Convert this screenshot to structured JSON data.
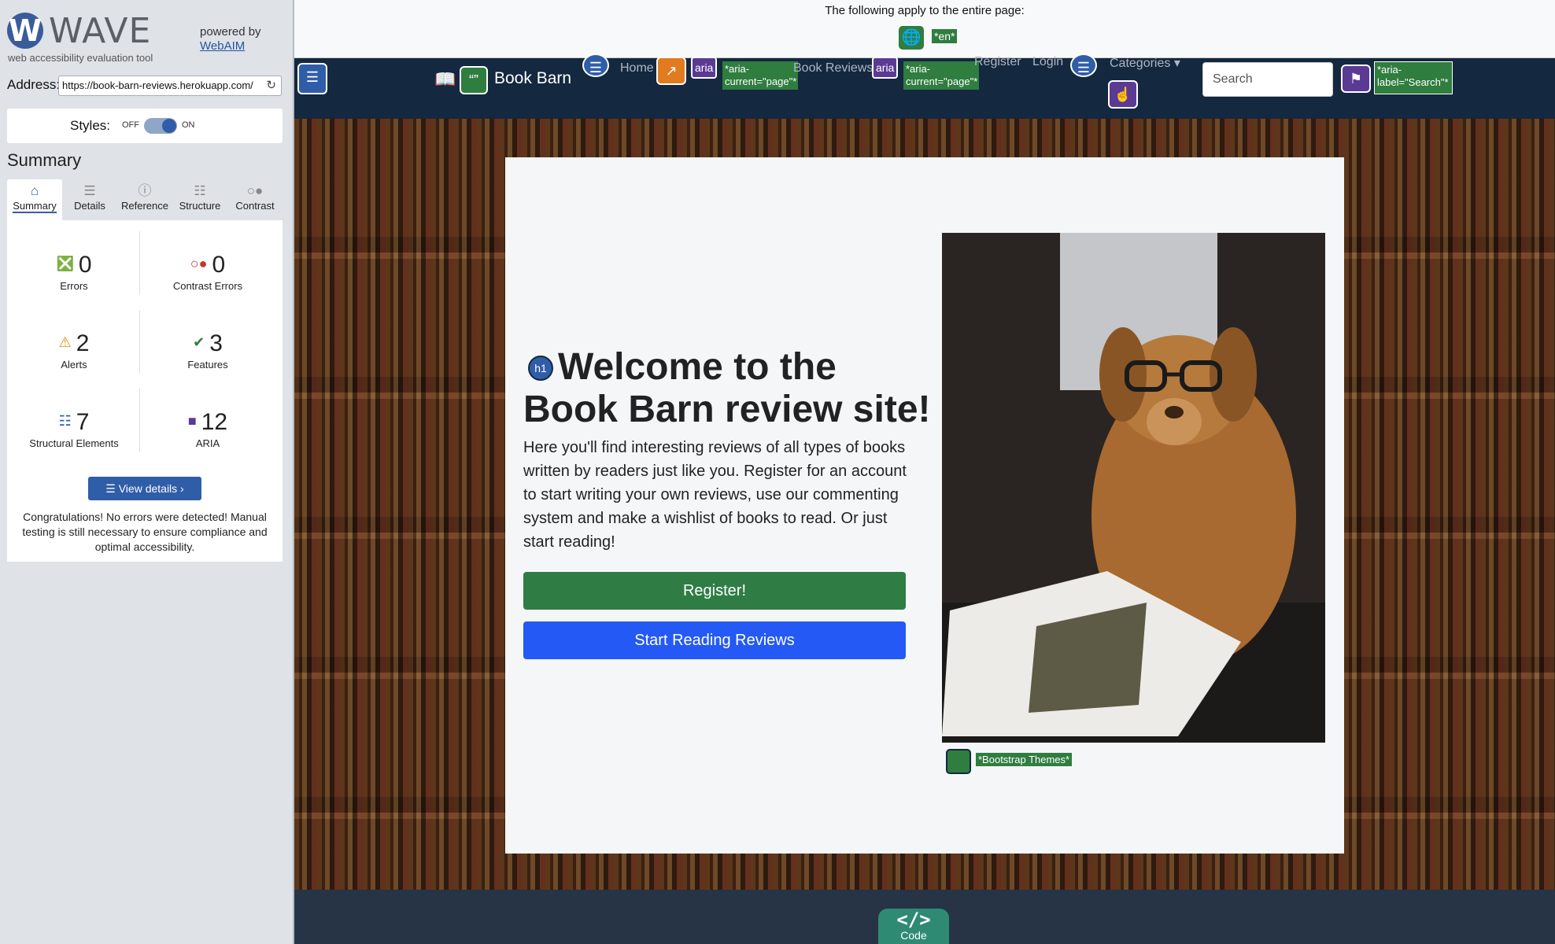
{
  "wave": {
    "logo_text": "WAVE",
    "tagline": "web accessibility evaluation tool",
    "powered_by": "powered by",
    "webaim_link": "WebAIM",
    "address_label": "Address:",
    "address_value": "https://book-barn-reviews.herokuapp.com/",
    "styles_label": "Styles:",
    "styles_off": "OFF",
    "styles_on": "ON",
    "summary_heading": "Summary",
    "tabs": [
      {
        "label": "Summary",
        "icon": "home-icon",
        "active": true
      },
      {
        "label": "Details",
        "icon": "list-icon"
      },
      {
        "label": "Reference",
        "icon": "info-icon"
      },
      {
        "label": "Structure",
        "icon": "hierarchy-icon"
      },
      {
        "label": "Contrast",
        "icon": "contrast-icon"
      }
    ],
    "stats": {
      "errors": {
        "value": "0",
        "label": "Errors"
      },
      "contrast_errors": {
        "value": "0",
        "label": "Contrast Errors"
      },
      "alerts": {
        "value": "2",
        "label": "Alerts"
      },
      "features": {
        "value": "3",
        "label": "Features"
      },
      "structural": {
        "value": "7",
        "label": "Structural Elements"
      },
      "aria": {
        "value": "12",
        "label": "ARIA"
      }
    },
    "view_details": "View details ›",
    "congrats": "Congratulations! No errors were detected! Manual testing is still necessary to ensure compliance and optimal accessibility."
  },
  "page_note": {
    "text": "The following apply to the entire page:",
    "lang_tag": "*en*"
  },
  "nav": {
    "brand": "Book Barn",
    "home": "Home",
    "book_reviews": "Book Reviews",
    "aria_current_1": "*aria-current=\"page\"*",
    "aria_current_2": "*aria-current=\"page\"*",
    "aria_label_tag": "aria",
    "register": "Register",
    "login": "Login",
    "categories": "Categories",
    "search_placeholder": "Search",
    "aria_label_search": "*aria-label=\"Search\"*"
  },
  "hero": {
    "heading_tag": "h1",
    "heading": "Welcome to the Book Barn review site!",
    "lead": "Here you'll find interesting reviews of all types of books written by readers just like you. Register for an account to start writing your own reviews, use our commenting system and make a wishlist of books to read. Or just start reading!",
    "register_button": "Register!",
    "start_button": "Start Reading Reviews",
    "image_alt_tag": "*Bootstrap Themes*"
  },
  "footer": {
    "code_label": "Code",
    "code_icon": "</>"
  },
  "colors": {
    "navbar": "#14283f",
    "register_green": "#2f7d44",
    "start_blue": "#2459f5",
    "wave_blue": "#2f5da8",
    "wave_green_tag": "#2f7d3f"
  }
}
